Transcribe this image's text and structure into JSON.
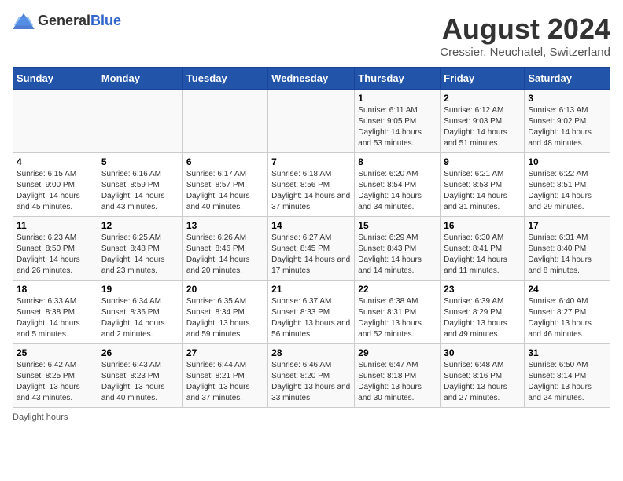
{
  "header": {
    "logo_general": "General",
    "logo_blue": "Blue",
    "main_title": "August 2024",
    "subtitle": "Cressier, Neuchatel, Switzerland"
  },
  "days_of_week": [
    "Sunday",
    "Monday",
    "Tuesday",
    "Wednesday",
    "Thursday",
    "Friday",
    "Saturday"
  ],
  "footer": {
    "note": "Daylight hours"
  },
  "weeks": [
    [
      {
        "day": "",
        "info": ""
      },
      {
        "day": "",
        "info": ""
      },
      {
        "day": "",
        "info": ""
      },
      {
        "day": "",
        "info": ""
      },
      {
        "day": "1",
        "info": "Sunrise: 6:11 AM\nSunset: 9:05 PM\nDaylight: 14 hours and 53 minutes."
      },
      {
        "day": "2",
        "info": "Sunrise: 6:12 AM\nSunset: 9:03 PM\nDaylight: 14 hours and 51 minutes."
      },
      {
        "day": "3",
        "info": "Sunrise: 6:13 AM\nSunset: 9:02 PM\nDaylight: 14 hours and 48 minutes."
      }
    ],
    [
      {
        "day": "4",
        "info": "Sunrise: 6:15 AM\nSunset: 9:00 PM\nDaylight: 14 hours and 45 minutes."
      },
      {
        "day": "5",
        "info": "Sunrise: 6:16 AM\nSunset: 8:59 PM\nDaylight: 14 hours and 43 minutes."
      },
      {
        "day": "6",
        "info": "Sunrise: 6:17 AM\nSunset: 8:57 PM\nDaylight: 14 hours and 40 minutes."
      },
      {
        "day": "7",
        "info": "Sunrise: 6:18 AM\nSunset: 8:56 PM\nDaylight: 14 hours and 37 minutes."
      },
      {
        "day": "8",
        "info": "Sunrise: 6:20 AM\nSunset: 8:54 PM\nDaylight: 14 hours and 34 minutes."
      },
      {
        "day": "9",
        "info": "Sunrise: 6:21 AM\nSunset: 8:53 PM\nDaylight: 14 hours and 31 minutes."
      },
      {
        "day": "10",
        "info": "Sunrise: 6:22 AM\nSunset: 8:51 PM\nDaylight: 14 hours and 29 minutes."
      }
    ],
    [
      {
        "day": "11",
        "info": "Sunrise: 6:23 AM\nSunset: 8:50 PM\nDaylight: 14 hours and 26 minutes."
      },
      {
        "day": "12",
        "info": "Sunrise: 6:25 AM\nSunset: 8:48 PM\nDaylight: 14 hours and 23 minutes."
      },
      {
        "day": "13",
        "info": "Sunrise: 6:26 AM\nSunset: 8:46 PM\nDaylight: 14 hours and 20 minutes."
      },
      {
        "day": "14",
        "info": "Sunrise: 6:27 AM\nSunset: 8:45 PM\nDaylight: 14 hours and 17 minutes."
      },
      {
        "day": "15",
        "info": "Sunrise: 6:29 AM\nSunset: 8:43 PM\nDaylight: 14 hours and 14 minutes."
      },
      {
        "day": "16",
        "info": "Sunrise: 6:30 AM\nSunset: 8:41 PM\nDaylight: 14 hours and 11 minutes."
      },
      {
        "day": "17",
        "info": "Sunrise: 6:31 AM\nSunset: 8:40 PM\nDaylight: 14 hours and 8 minutes."
      }
    ],
    [
      {
        "day": "18",
        "info": "Sunrise: 6:33 AM\nSunset: 8:38 PM\nDaylight: 14 hours and 5 minutes."
      },
      {
        "day": "19",
        "info": "Sunrise: 6:34 AM\nSunset: 8:36 PM\nDaylight: 14 hours and 2 minutes."
      },
      {
        "day": "20",
        "info": "Sunrise: 6:35 AM\nSunset: 8:34 PM\nDaylight: 13 hours and 59 minutes."
      },
      {
        "day": "21",
        "info": "Sunrise: 6:37 AM\nSunset: 8:33 PM\nDaylight: 13 hours and 56 minutes."
      },
      {
        "day": "22",
        "info": "Sunrise: 6:38 AM\nSunset: 8:31 PM\nDaylight: 13 hours and 52 minutes."
      },
      {
        "day": "23",
        "info": "Sunrise: 6:39 AM\nSunset: 8:29 PM\nDaylight: 13 hours and 49 minutes."
      },
      {
        "day": "24",
        "info": "Sunrise: 6:40 AM\nSunset: 8:27 PM\nDaylight: 13 hours and 46 minutes."
      }
    ],
    [
      {
        "day": "25",
        "info": "Sunrise: 6:42 AM\nSunset: 8:25 PM\nDaylight: 13 hours and 43 minutes."
      },
      {
        "day": "26",
        "info": "Sunrise: 6:43 AM\nSunset: 8:23 PM\nDaylight: 13 hours and 40 minutes."
      },
      {
        "day": "27",
        "info": "Sunrise: 6:44 AM\nSunset: 8:21 PM\nDaylight: 13 hours and 37 minutes."
      },
      {
        "day": "28",
        "info": "Sunrise: 6:46 AM\nSunset: 8:20 PM\nDaylight: 13 hours and 33 minutes."
      },
      {
        "day": "29",
        "info": "Sunrise: 6:47 AM\nSunset: 8:18 PM\nDaylight: 13 hours and 30 minutes."
      },
      {
        "day": "30",
        "info": "Sunrise: 6:48 AM\nSunset: 8:16 PM\nDaylight: 13 hours and 27 minutes."
      },
      {
        "day": "31",
        "info": "Sunrise: 6:50 AM\nSunset: 8:14 PM\nDaylight: 13 hours and 24 minutes."
      }
    ]
  ]
}
